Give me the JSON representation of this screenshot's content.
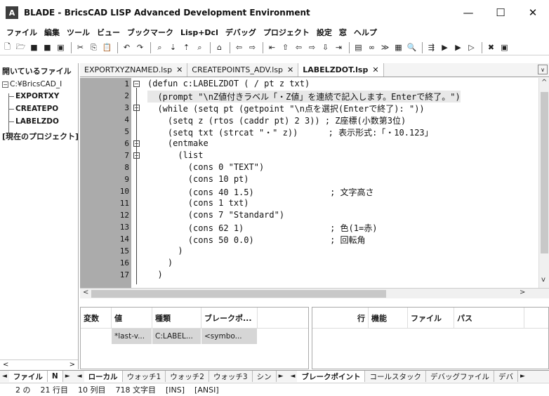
{
  "window": {
    "app_icon_label": "A",
    "title": "BLADE - BricsCAD LISP Advanced Development Environment",
    "controls": {
      "minimize": "—",
      "maximize": "☐",
      "close": "✕"
    }
  },
  "menu": [
    "ファイル",
    "編集",
    "ツール",
    "ビュー",
    "ブックマーク",
    "Lisp+Dcl",
    "デバッグ",
    "プロジェクト",
    "設定",
    "窓",
    "ヘルプ"
  ],
  "left_panel": {
    "header": "開いているファイル",
    "root_toggle": "−",
    "root": "C:¥BricsCAD_I",
    "files": [
      "EXPORTXY",
      "CREATEPO",
      "LABELZDO"
    ],
    "current_project": "[現在のプロジェクト]",
    "scroll_left": "<",
    "scroll_right": ">"
  },
  "editor_tabs": [
    {
      "label": "EXPORTXYZNAMED.lsp",
      "close": "✕",
      "active": false
    },
    {
      "label": "CREATEPOINTS_ADV.lsp",
      "close": "✕",
      "active": false
    },
    {
      "label": "LABELZDOT.lsp",
      "close": "✕",
      "active": true
    }
  ],
  "tab_menu_icon": "∨",
  "editor": {
    "lines": [
      {
        "n": "1",
        "text": "(defun c:LABELZDOT ( / pt z txt)"
      },
      {
        "n": "2",
        "text": "  (prompt \"\\nZ値付きラベル「・Z値」を連続で記入します。Enterで終了。\")"
      },
      {
        "n": "3",
        "text": "  (while (setq pt (getpoint \"\\n点を選択(Enterで終了): \"))"
      },
      {
        "n": "4",
        "text": "    (setq z (rtos (caddr pt) 2 3)) ; Z座標(小数第3位)"
      },
      {
        "n": "5",
        "text": "    (setq txt (strcat \"・\" z))      ; 表示形式:「・10.123」"
      },
      {
        "n": "6",
        "text": "    (entmake"
      },
      {
        "n": "7",
        "text": "      (list"
      },
      {
        "n": "8",
        "text": "        (cons 0 \"TEXT\")"
      },
      {
        "n": "9",
        "text": "        (cons 10 pt)"
      },
      {
        "n": "10",
        "text": "        (cons 40 1.5)               ; 文字高さ"
      },
      {
        "n": "11",
        "text": "        (cons 1 txt)"
      },
      {
        "n": "12",
        "text": "        (cons 7 \"Standard\")"
      },
      {
        "n": "13",
        "text": "        (cons 62 1)                 ; 色(1=赤)"
      },
      {
        "n": "14",
        "text": "        (cons 50 0.0)               ; 回転角"
      },
      {
        "n": "15",
        "text": "      )"
      },
      {
        "n": "16",
        "text": "    )"
      },
      {
        "n": "17",
        "text": "  )"
      }
    ],
    "fold_expanded": "−",
    "scroll_up": "^",
    "scroll_down": "v",
    "scroll_left": "<",
    "scroll_right": ">"
  },
  "variables_panel": {
    "headers": [
      "変数",
      "値",
      "種類",
      "ブレークポ..."
    ],
    "rows": [
      [
        "*last-v...",
        "C:LABEL...",
        "<symbo...",
        ""
      ]
    ]
  },
  "breakpoints_panel": {
    "headers": [
      "行",
      "機能",
      "ファイル",
      "パス"
    ]
  },
  "bottom_tabs_left": {
    "prev": "◄",
    "tabs": [
      "ファイル",
      "N"
    ],
    "next": "►"
  },
  "bottom_tabs_mid": {
    "prev": "◄",
    "tabs": [
      "ローカル",
      "ウォッチ1",
      "ウォッチ2",
      "ウォッチ3",
      "シン"
    ],
    "next": "►"
  },
  "bottom_tabs_right": {
    "prev": "◄",
    "tabs": [
      "ブレークポイント",
      "コールスタック",
      "デバッグファイル",
      "デバ"
    ],
    "next": "►"
  },
  "status": [
    "2 の",
    "21 行目",
    "10 列目",
    "718 文字目",
    "[INS]",
    "[ANSI]"
  ]
}
